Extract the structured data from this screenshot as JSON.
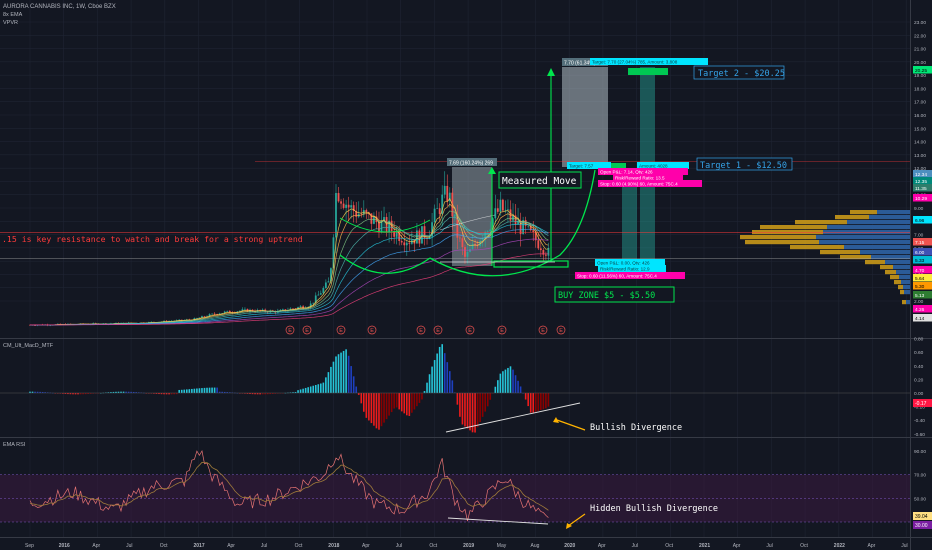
{
  "header": {
    "symbol_line": "AURORA CANNABIS INC, 1W, Cboe BZX",
    "indicator_1": "8x EMA",
    "indicator_2": "VPVR"
  },
  "colors": {
    "background": "#131722",
    "grid": "#1f2433",
    "text": "#b2b5be",
    "up": "#26a69a",
    "down": "#ef5350",
    "green_line": "#00e64d",
    "label_green": "#00e676",
    "label_cyan": "#00e5ff",
    "label_pink": "#ff00aa",
    "annotation_blue": "#35a3e8",
    "resistance_red": "#ff3b3b"
  },
  "x_axis": {
    "labels": [
      "Sep",
      "2016",
      "Apr",
      "Jul",
      "Oct",
      "2017",
      "Apr",
      "Jul",
      "Oct",
      "2018",
      "Apr",
      "Jul",
      "Oct",
      "2019",
      "May",
      "Aug",
      "2020",
      "Apr",
      "Jul",
      "Oct",
      "2021",
      "Apr",
      "Jul",
      "Oct",
      "2022",
      "Apr",
      "Jul"
    ]
  },
  "main_panel": {
    "price_ticks": [
      "23.00",
      "22.00",
      "21.00",
      "20.00",
      "19.00",
      "18.00",
      "17.00",
      "16.00",
      "15.00",
      "14.00",
      "13.00",
      "12.00",
      "11.00",
      "10.00",
      "9.00",
      "8.00",
      "7.00",
      "6.00",
      "5.00",
      "4.00",
      "3.00",
      "2.00"
    ],
    "price_labels": [
      {
        "text": "12.34",
        "color": "#4d8fbf"
      },
      {
        "text": "12.35",
        "color": "#00897b"
      },
      {
        "text": "11.35",
        "color": "#2e7d6b"
      },
      {
        "text": "10.29",
        "color": "#ff00aa"
      },
      {
        "text": "6.96",
        "color": "#00e5ff"
      },
      {
        "text": "7.15",
        "color": "#ef5350"
      },
      {
        "text": "6.00",
        "color": "#3f51b5"
      },
      {
        "text": "5.33",
        "color": "#00bcd4"
      },
      {
        "text": "4.70",
        "color": "#ff00aa"
      },
      {
        "text": "5.64",
        "color": "#ffeb3b"
      },
      {
        "text": "5.30",
        "color": "#ff9800"
      },
      {
        "text": "5.13",
        "color": "#2e7d32"
      },
      {
        "text": "4.26",
        "color": "#ff00aa"
      },
      {
        "text": "4.14",
        "color": "#e0e0e0"
      },
      {
        "text": "20.25",
        "color": "#00e676"
      }
    ],
    "earnings_marker": "E",
    "resistance_text": ".15 is key resistance to watch and break for a strong uptrend",
    "measured_move_label": "Measured Move",
    "measure_box_1_label": "7.69 (160.24%) 269",
    "measure_box_2_label": "7.70 (61.34%) 273",
    "target_1": "Target 1 -  $12.50",
    "target_2": "Target 2 - $20.25",
    "buy_zone": "BUY ZONE $5 - $5.50",
    "trade1_labels": {
      "target": "Target: 7.57",
      "mid": "Amount: 4028",
      "open_pnl": "Open P&L: 7.14, Qty: 426",
      "rr": "Risk/Reward Ratio: 13.5",
      "stop": "Stop: 0.60 (4.90%) 60, Amount: 75C.4"
    },
    "trade2_labels": {
      "target": "Target: 7.70 (27.04%) 785, Amount: 3,808",
      "entry": "Open P&L: 0.00, Qty: 426",
      "rr": "Risk/Reward Ratio: 12.9",
      "stop": "Stop: 0.60 (11.56%) 60, Amount: 75C.4"
    }
  },
  "macd_panel": {
    "title": "CM_Ult_MacD_MTF",
    "ticks": [
      "0.80",
      "0.60",
      "0.40",
      "0.20",
      "0.00",
      "-0.20",
      "-0.40",
      "-0.60"
    ],
    "last_value": "-0.17",
    "annotation": "Bullish Divergence"
  },
  "rsi_panel": {
    "title": "EMA RSI",
    "ticks": [
      "90.00",
      "70.00",
      "50.00",
      "30.00"
    ],
    "last_value_1": "39.04",
    "last_value_2": "30.00",
    "annotation": "Hidden Bullish Divergence"
  },
  "chart_data": [
    {
      "type": "candlestick",
      "title": "AURORA CANNABIS INC, 1W, Cboe BZX",
      "x": [
        "2015-09",
        "2016-01",
        "2016-04",
        "2016-07",
        "2016-10",
        "2017-01",
        "2017-04",
        "2017-07",
        "2017-10",
        "2018-01",
        "2018-02",
        "2018-04",
        "2018-07",
        "2018-10",
        "2018-12",
        "2019-01",
        "2019-03",
        "2019-05",
        "2019-08"
      ],
      "close": [
        0.2,
        0.3,
        0.35,
        0.5,
        1.0,
        1.2,
        1.3,
        1.4,
        2.0,
        11.0,
        9.0,
        8.0,
        7.0,
        11.0,
        5.5,
        7.5,
        10.0,
        7.0,
        5.5
      ],
      "ylim": [
        0,
        23
      ],
      "resistance": 7.15,
      "buy_zone": [
        5.0,
        5.5
      ],
      "targets": [
        12.5,
        20.25
      ],
      "volume_profile": true
    },
    {
      "type": "bar",
      "title": "CM_Ult_MacD_MTF",
      "x": [
        "2018-01",
        "2018-04",
        "2018-07",
        "2018-10",
        "2019-01",
        "2019-05",
        "2019-08"
      ],
      "values": [
        0.65,
        -0.55,
        -0.45,
        0.75,
        -0.6,
        0.4,
        -0.3
      ],
      "ylim": [
        -0.6,
        0.8
      ]
    },
    {
      "type": "line",
      "title": "EMA RSI",
      "x": [
        "2016-10",
        "2017-10",
        "2018-01",
        "2018-07",
        "2018-10",
        "2019-01",
        "2019-03",
        "2019-08"
      ],
      "values": [
        88,
        60,
        85,
        45,
        80,
        35,
        65,
        30
      ],
      "ylim": [
        25,
        95
      ]
    }
  ]
}
